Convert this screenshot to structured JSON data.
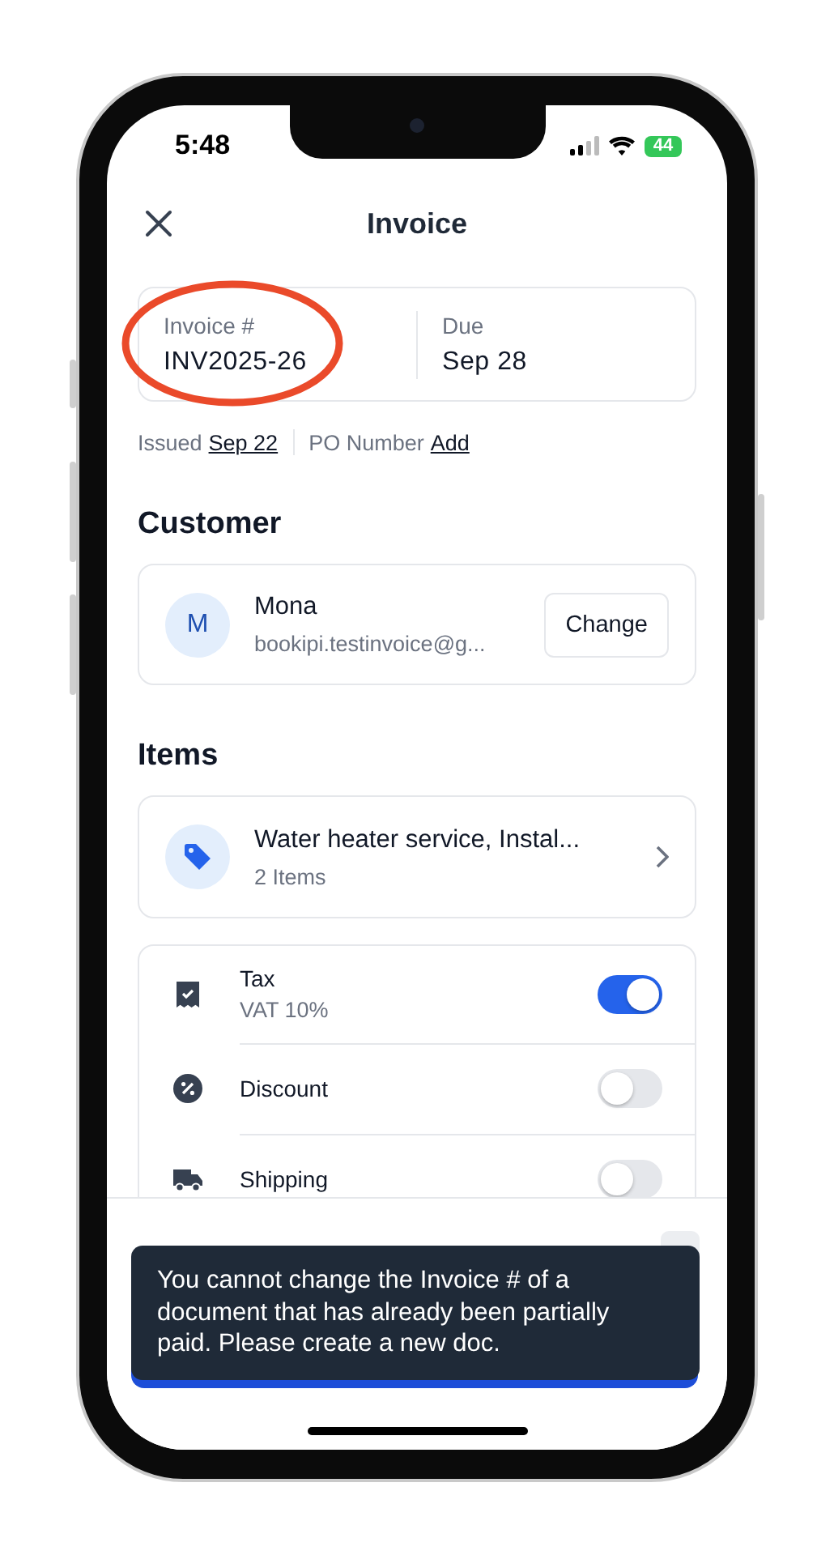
{
  "status_bar": {
    "time": "5:48",
    "battery": "44"
  },
  "header": {
    "title": "Invoice"
  },
  "invoice_card": {
    "number_label": "Invoice #",
    "number": "INV2025-26",
    "due_label": "Due",
    "due": "Sep 28"
  },
  "meta": [
    {
      "label": "Issued",
      "value": "Sep 22"
    },
    {
      "label": "PO Number",
      "value": "Add"
    }
  ],
  "customer": {
    "heading": "Customer",
    "initial": "M",
    "name": "Mona",
    "email": "bookipi.testinvoice@g...",
    "button": "Change"
  },
  "items": {
    "heading": "Items",
    "title": "Water heater service, Instal...",
    "count": "2 Items"
  },
  "options": [
    {
      "label": "Tax",
      "sub": "VAT 10%",
      "on": true
    },
    {
      "label": "Discount",
      "on": false
    },
    {
      "label": "Shipping",
      "on": false
    }
  ],
  "toast": {
    "message": "You cannot change the Invoice # of a document that has already been partially paid. Please create a new doc."
  }
}
